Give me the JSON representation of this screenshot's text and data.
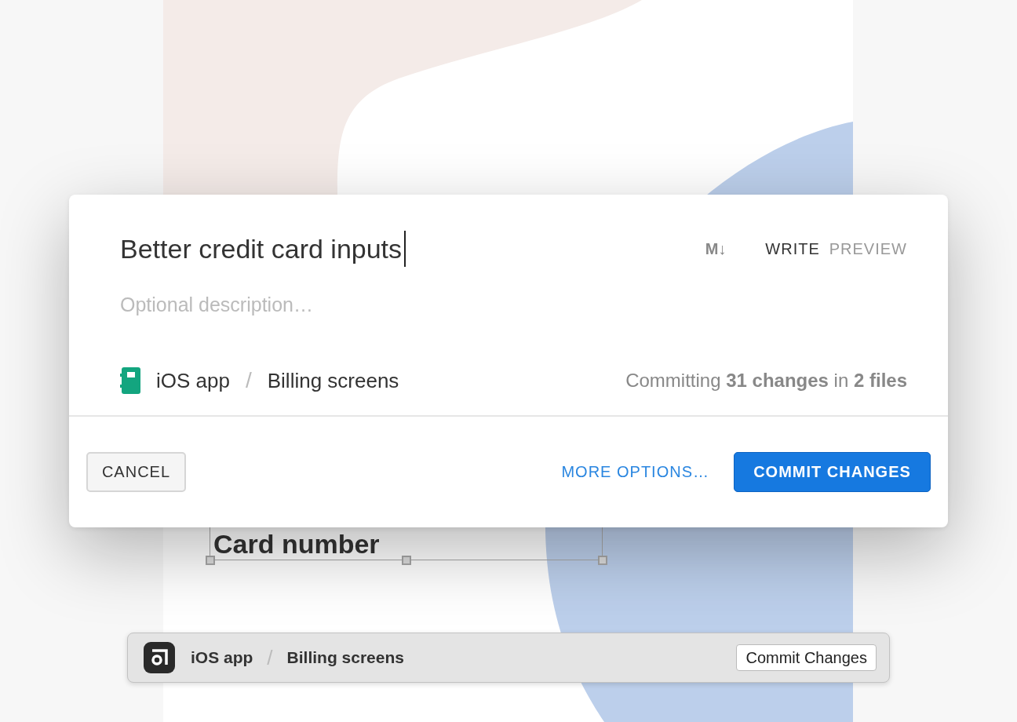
{
  "canvas": {
    "layer_text": "Card number"
  },
  "commit_dialog": {
    "title_field": {
      "value": "Better credit card inputs"
    },
    "markdown_icon": "M↓",
    "tabs": [
      {
        "label": "WRITE",
        "selected": true
      },
      {
        "label": "PREVIEW",
        "selected": false
      }
    ],
    "description_field": {
      "placeholder": "Optional description…"
    },
    "breadcrumb": {
      "project": "iOS app",
      "separator": "/",
      "page": "Billing screens"
    },
    "summary": "Committing **31 changes** in **2 files**",
    "cancel_button": "CANCEL",
    "more_options_link": "MORE OPTIONS…",
    "commit_button": "COMMIT CHANGES"
  },
  "toolbar": {
    "project": "iOS app",
    "separator": "/",
    "page": "Billing screens",
    "commit_button": "Commit Changes"
  }
}
